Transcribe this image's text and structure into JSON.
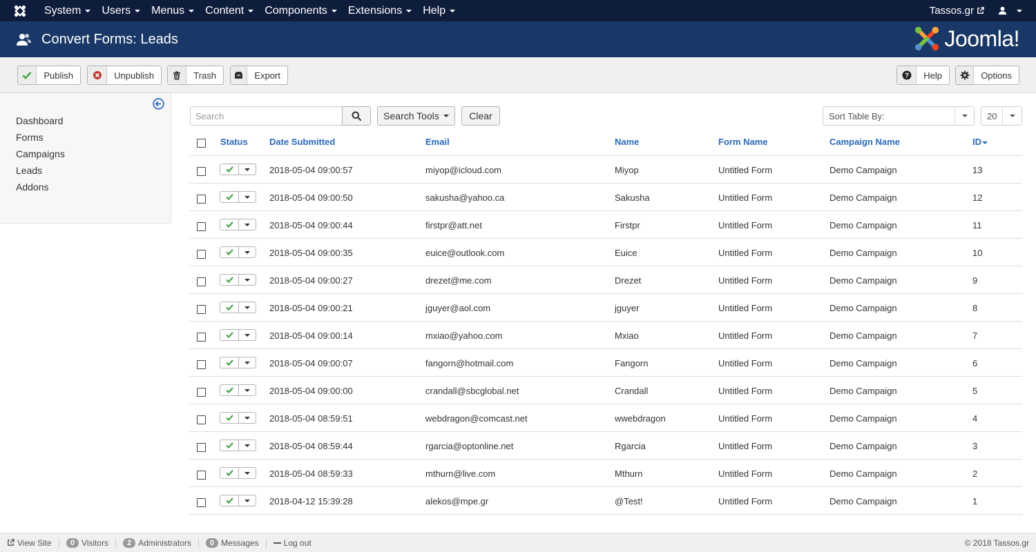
{
  "navbar": {
    "menu": [
      {
        "label": "System"
      },
      {
        "label": "Users"
      },
      {
        "label": "Menus"
      },
      {
        "label": "Content"
      },
      {
        "label": "Components"
      },
      {
        "label": "Extensions"
      },
      {
        "label": "Help"
      }
    ],
    "site_link": "Tassos.gr"
  },
  "header": {
    "title": "Convert Forms: Leads",
    "brand": "Joomla!"
  },
  "toolbar": {
    "publish": "Publish",
    "unpublish": "Unpublish",
    "trash": "Trash",
    "export": "Export",
    "help": "Help",
    "options": "Options"
  },
  "sidebar": {
    "items": [
      "Dashboard",
      "Forms",
      "Campaigns",
      "Leads",
      "Addons"
    ]
  },
  "filters": {
    "search_placeholder": "Search",
    "search_tools": "Search Tools",
    "clear": "Clear",
    "sort_label": "Sort Table By:",
    "limit": "20"
  },
  "table": {
    "headers": {
      "status": "Status",
      "date": "Date Submitted",
      "email": "Email",
      "name": "Name",
      "form": "Form Name",
      "campaign": "Campaign Name",
      "id": "ID"
    },
    "rows": [
      {
        "date": "2018-05-04 09:00:57",
        "email": "miyop@icloud.com",
        "name": "Miyop",
        "form": "Untitled Form",
        "campaign": "Demo Campaign",
        "id": "13"
      },
      {
        "date": "2018-05-04 09:00:50",
        "email": "sakusha@yahoo.ca",
        "name": "Sakusha",
        "form": "Untitled Form",
        "campaign": "Demo Campaign",
        "id": "12"
      },
      {
        "date": "2018-05-04 09:00:44",
        "email": "firstpr@att.net",
        "name": "Firstpr",
        "form": "Untitled Form",
        "campaign": "Demo Campaign",
        "id": "11"
      },
      {
        "date": "2018-05-04 09:00:35",
        "email": "euice@outlook.com",
        "name": "Euice",
        "form": "Untitled Form",
        "campaign": "Demo Campaign",
        "id": "10"
      },
      {
        "date": "2018-05-04 09:00:27",
        "email": "drezet@me.com",
        "name": "Drezet",
        "form": "Untitled Form",
        "campaign": "Demo Campaign",
        "id": "9"
      },
      {
        "date": "2018-05-04 09:00:21",
        "email": "jguyer@aol.com",
        "name": "jguyer",
        "form": "Untitled Form",
        "campaign": "Demo Campaign",
        "id": "8"
      },
      {
        "date": "2018-05-04 09:00:14",
        "email": "mxiao@yahoo.com",
        "name": "Mxiao",
        "form": "Untitled Form",
        "campaign": "Demo Campaign",
        "id": "7"
      },
      {
        "date": "2018-05-04 09:00:07",
        "email": "fangorn@hotmail.com",
        "name": "Fangorn",
        "form": "Untitled Form",
        "campaign": "Demo Campaign",
        "id": "6"
      },
      {
        "date": "2018-05-04 09:00:00",
        "email": "crandall@sbcglobal.net",
        "name": "Crandall",
        "form": "Untitled Form",
        "campaign": "Demo Campaign",
        "id": "5"
      },
      {
        "date": "2018-05-04 08:59:51",
        "email": "webdragon@comcast.net",
        "name": "wwebdragon",
        "form": "Untitled Form",
        "campaign": "Demo Campaign",
        "id": "4"
      },
      {
        "date": "2018-05-04 08:59:44",
        "email": "rgarcia@optonline.net",
        "name": "Rgarcia",
        "form": "Untitled Form",
        "campaign": "Demo Campaign",
        "id": "3"
      },
      {
        "date": "2018-05-04 08:59:33",
        "email": "mthurn@live.com",
        "name": "Mthurn",
        "form": "Untitled Form",
        "campaign": "Demo Campaign",
        "id": "2"
      },
      {
        "date": "2018-04-12 15:39:28",
        "email": "alekos@mpe.gr",
        "name": "@Test!",
        "form": "Untitled Form",
        "campaign": "Demo Campaign",
        "id": "1"
      }
    ]
  },
  "footer": {
    "view_site": "View Site",
    "visitors_count": "0",
    "visitors": "Visitors",
    "admins_count": "2",
    "admins": "Administrators",
    "messages_count": "0",
    "messages": "Messages",
    "logout": "Log out",
    "copyright": "© 2018 Tassos.gr"
  },
  "colors": {
    "navbar": "#0f1d3d",
    "header": "#1a3867",
    "link": "#2a69b8",
    "published": "#46a546",
    "unpublish": "#bd362f"
  },
  "icons": {
    "nav_logo": "joomla-icon",
    "header": "users-icon",
    "publish": "check-icon",
    "unpublish": "cancel-circle-icon",
    "trash": "trash-icon",
    "export": "export-icon",
    "help": "question-icon",
    "options": "gear-icon",
    "sidebar_toggle": "arrow-left-circle-icon",
    "search": "search-icon",
    "user": "user-icon",
    "external": "external-link-icon"
  }
}
